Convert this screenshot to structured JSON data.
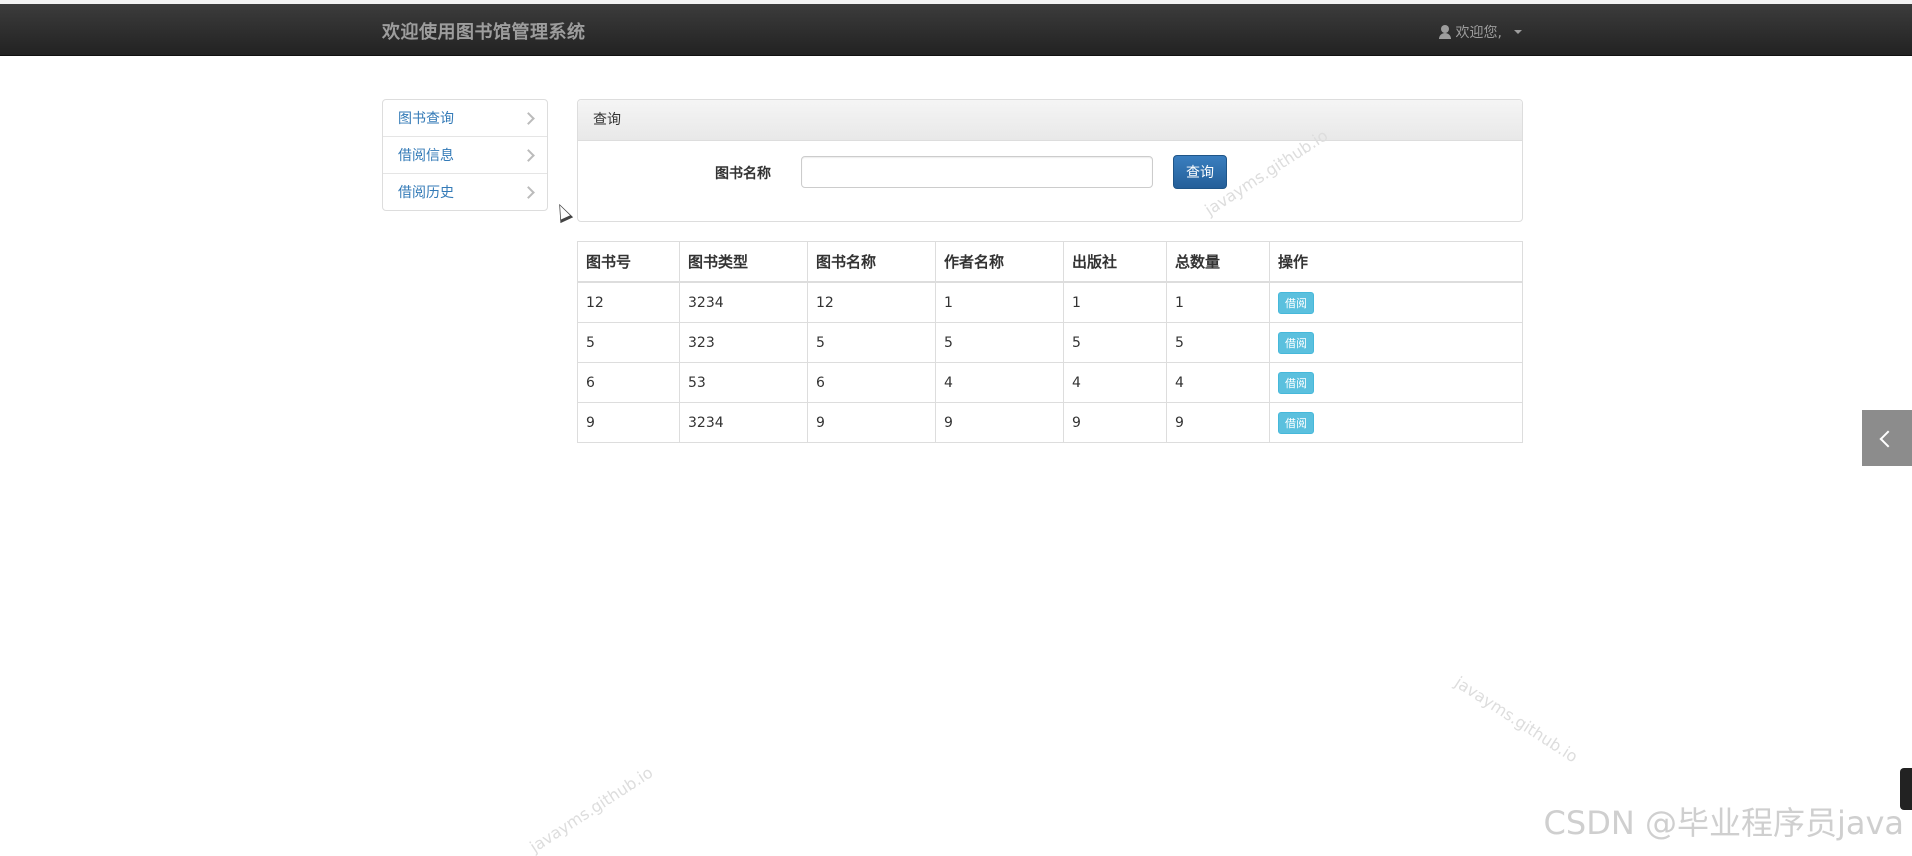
{
  "navbar": {
    "brand": "欢迎使用图书馆管理系统",
    "user_label": "欢迎您,"
  },
  "sidebar": {
    "items": [
      {
        "label": "图书查询"
      },
      {
        "label": "借阅信息"
      },
      {
        "label": "借阅历史"
      }
    ]
  },
  "query_panel": {
    "title": "查询",
    "field_label": "图书名称",
    "input_value": "",
    "button_label": "查询"
  },
  "table": {
    "headers": [
      "图书号",
      "图书类型",
      "图书名称",
      "作者名称",
      "出版社",
      "总数量",
      "操作"
    ],
    "action_label": "借阅",
    "rows": [
      [
        "12",
        "3234",
        "12",
        "1",
        "1",
        "1"
      ],
      [
        "5",
        "323",
        "5",
        "5",
        "5",
        "5"
      ],
      [
        "6",
        "53",
        "6",
        "4",
        "4",
        "4"
      ],
      [
        "9",
        "3234",
        "9",
        "9",
        "9",
        "9"
      ]
    ]
  },
  "watermarks": {
    "site": "javayms.github.io",
    "csdn": "CSDN @毕业程序员java"
  }
}
